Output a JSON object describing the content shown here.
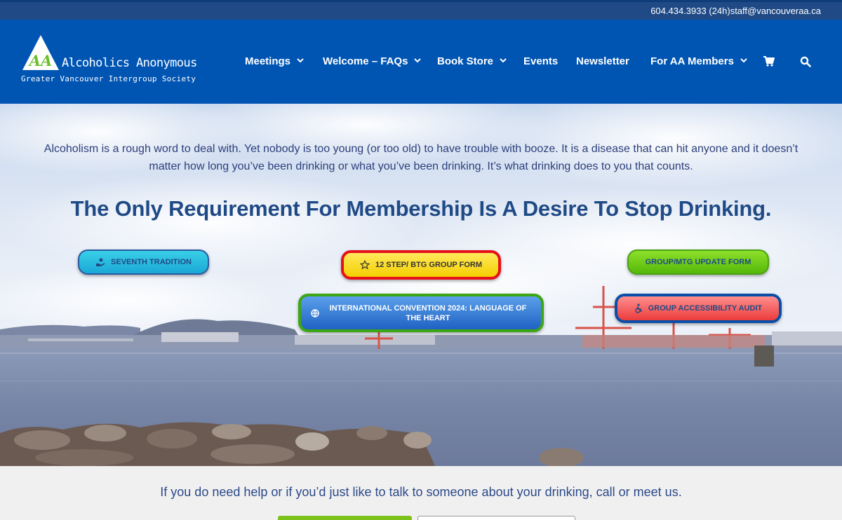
{
  "topbar": {
    "phone": "604.434.3933 (24h)",
    "email": "staff@vancouveraa.ca"
  },
  "logo": {
    "mark": "AA",
    "title": "Alcoholics Anonymous",
    "subtitle": "Greater Vancouver Intergroup Society"
  },
  "nav": {
    "items": [
      {
        "label": "Meetings",
        "has_dropdown": true
      },
      {
        "label": "Welcome – FAQs",
        "has_dropdown": true
      },
      {
        "label": "Book Store",
        "has_dropdown": true
      },
      {
        "label": "Events",
        "has_dropdown": false
      },
      {
        "label": "Newsletter",
        "has_dropdown": false
      },
      {
        "label": "For AA Members",
        "has_dropdown": true
      }
    ],
    "cart_icon": "shopping-cart-icon",
    "search_icon": "search-icon"
  },
  "hero": {
    "intro": "Alcoholism is a rough word to deal with. Yet nobody is too young (or too old) to have trouble with booze. It is a disease that can hit anyone and it doesn’t matter how long you’ve been drinking or what you’ve been drinking. It’s what drinking does to you that counts.",
    "headline": "The Only Requirement For Membership Is A Desire To Stop Drinking.",
    "buttons": {
      "seventh_tradition": "SEVENTH TRADITION",
      "twelve_step": "12 STEP/ BTG GROUP FORM",
      "group_update": "GROUP/MTG UPDATE FORM",
      "international": "INTERNATIONAL CONVENTION 2024: LANGUAGE OF THE HEART",
      "accessibility": "GROUP ACCESSIBILITY AUDIT"
    }
  },
  "footer_cta": {
    "text": "If you do need help or if you’d just like to talk to someone about your drinking, call or meet us."
  },
  "colors": {
    "header_bg": "#0055b3",
    "topbar_bg": "#1f4a86",
    "headline": "#1f4a86"
  }
}
